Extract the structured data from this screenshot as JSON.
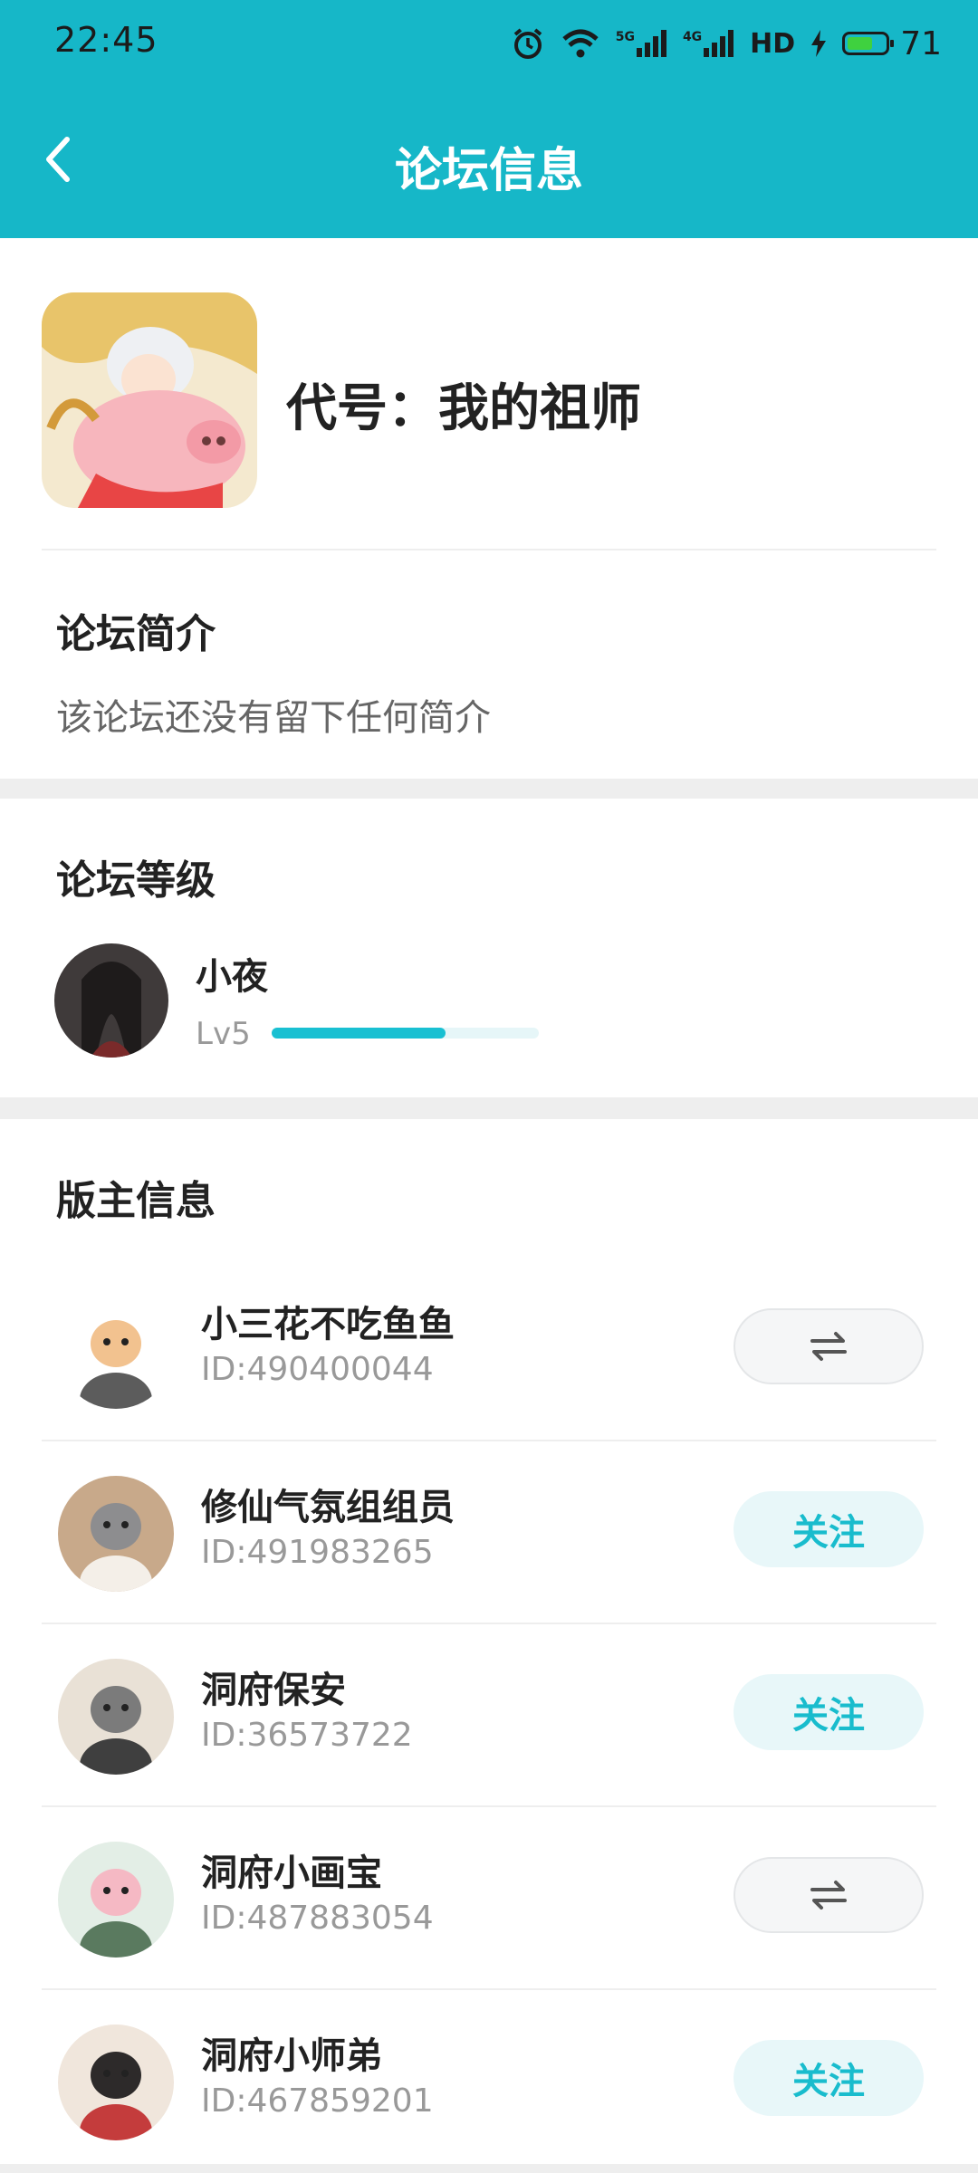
{
  "status_bar": {
    "time": "22:45",
    "network_5g": "5G",
    "network_4g": "4G",
    "hd": "HD",
    "battery": "71",
    "battery_level": 0.71
  },
  "header": {
    "title": "论坛信息",
    "background": "#16b7c8"
  },
  "forum": {
    "name": "代号：我的祖师"
  },
  "intro": {
    "title": "论坛简介",
    "text": "该论坛还没有留下任何简介"
  },
  "level": {
    "title": "论坛等级",
    "user_name": "小夜",
    "level_label": "Lv5",
    "progress": 0.65,
    "accent": "#19c0d2"
  },
  "moderators": {
    "title": "版主信息",
    "list": [
      {
        "name": "小三花不吃鱼鱼",
        "id": "ID:490400044",
        "action": "swap",
        "action_label": "⇌"
      },
      {
        "name": "修仙气氛组组员",
        "id": "ID:491983265",
        "action": "follow",
        "action_label": "关注"
      },
      {
        "name": "洞府保安",
        "id": "ID:36573722",
        "action": "follow",
        "action_label": "关注"
      },
      {
        "name": "洞府小画宝",
        "id": "ID:487883054",
        "action": "swap",
        "action_label": "⇌"
      },
      {
        "name": "洞府小师弟",
        "id": "ID:467859201",
        "action": "follow",
        "action_label": "关注"
      }
    ]
  }
}
